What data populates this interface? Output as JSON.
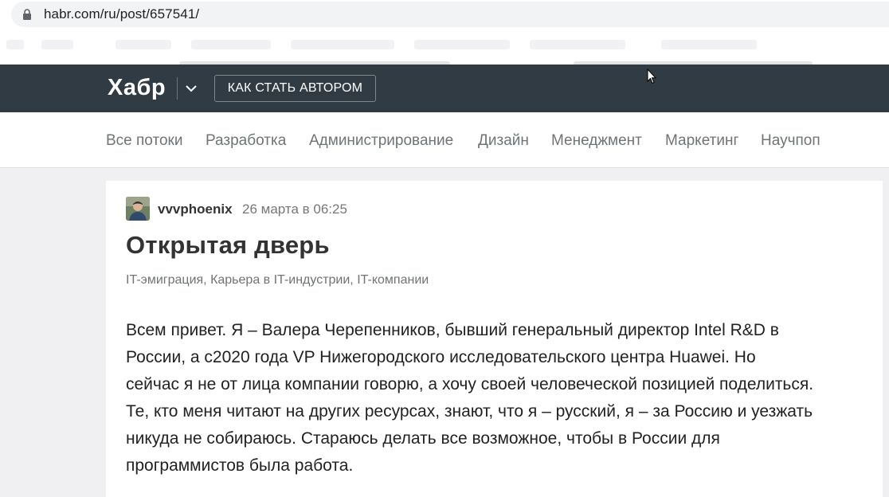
{
  "browser": {
    "url": "habr.com/ru/post/657541/"
  },
  "header": {
    "logo": "Хабр",
    "author_button": "КАК СТАТЬ АВТОРОМ"
  },
  "nav": {
    "items": [
      "Все потоки",
      "Разработка",
      "Администрирование",
      "Дизайн",
      "Менеджмент",
      "Маркетинг",
      "Научпоп"
    ]
  },
  "article": {
    "author": "vvvphoenix",
    "date": "26 марта в 06:25",
    "title": "Открытая дверь",
    "hubs": [
      "IT-эмиграция",
      "Карьера в IT-индустрии",
      "IT-компании"
    ],
    "body_lines": [
      "Всем привет. Я – Валера Черепенников, бывший генеральный директор Intel R&D в",
      "России, а с2020 года VP Нижегородского исследовательского центра Huawei. Но",
      "сейчас я не от лица компании говорю, а хочу своей человеческой позицией поделиться.",
      "Те, кто меня читают на других ресурсах, знают, что я – русский, я – за Россию и уезжать",
      "никуда не собираюсь. Стараюсь делать все возможное, чтобы в России для",
      "программистов была работа."
    ]
  },
  "colors": {
    "header_bg": "#303b44",
    "card_bg": "#ffffff",
    "page_bg": "#f0f0f2"
  }
}
